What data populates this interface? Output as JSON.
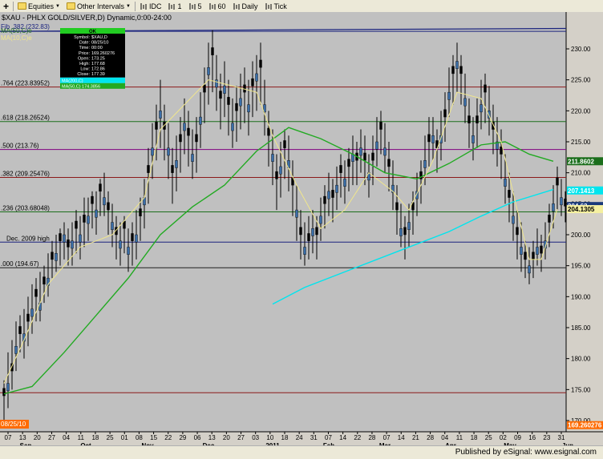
{
  "toolbar": {
    "items": [
      {
        "label": "Equities",
        "icon": "folder-icon",
        "dropdown": true
      },
      {
        "label": "Other Intervals",
        "icon": "folder-icon",
        "dropdown": true
      },
      {
        "label": "IDC",
        "icon": "bar-icon"
      },
      {
        "label": "1",
        "icon": "bar-icon"
      },
      {
        "label": "5",
        "icon": "bar-icon"
      },
      {
        "label": "60",
        "icon": "bar-icon"
      },
      {
        "label": "Daily",
        "icon": "bar-icon"
      },
      {
        "label": "Tick",
        "icon": "bar-icon"
      }
    ]
  },
  "footer": {
    "text": "Published by eSignal: www.esignal.com"
  },
  "chart_data": {
    "type": "candlestick",
    "title": "$XAU - PHLX GOLD/SILVER,D) Dynamic,0:00-24:00",
    "xlabel": "",
    "ylabel": "",
    "ylim": [
      170,
      235
    ],
    "grid": false,
    "y_ticks": [
      170.0,
      175.0,
      180.0,
      185.0,
      190.0,
      195.0,
      200.0,
      205.0,
      210.0,
      215.0,
      220.0,
      225.0,
      230.0
    ],
    "y_tick_labels": [
      "170.00",
      "175.00",
      "180.00",
      "185.00",
      "190.00",
      "195.00",
      "200.00",
      "205.00",
      "210.00",
      "215.00",
      "220.00",
      "225.00",
      "230.00"
    ],
    "date_labels": [
      "07",
      "13",
      "20",
      "27",
      "04",
      "11",
      "18",
      "25",
      "01",
      "08",
      "15",
      "22",
      "29",
      "06",
      "13",
      "20",
      "27",
      "03",
      "10",
      "18",
      "24",
      "31",
      "07",
      "14",
      "22",
      "28",
      "07",
      "14",
      "21",
      "28",
      "04",
      "11",
      "18",
      "25",
      "02",
      "09",
      "16",
      "23",
      "31"
    ],
    "month_labels": [
      "Sep",
      "Oct",
      "Nov",
      "Dec",
      "2011",
      "Feb",
      "Mar",
      "Apr",
      "May",
      "Jun"
    ],
    "horizontal_levels": [
      {
        "label": "Fib .382 (232.83)",
        "value": 232.83,
        "color": "#1a237e"
      },
      {
        "label": ".764 (223.83952)",
        "value": 223.84,
        "color": "#8b1a1a"
      },
      {
        "label": ".618 (218.26524)",
        "value": 218.27,
        "color": "#1b6e1b"
      },
      {
        "label": ".500 (213.76)",
        "value": 213.76,
        "color": "#800080"
      },
      {
        "label": ".382 (209.25476)",
        "value": 209.25,
        "color": "#8b1a1a"
      },
      {
        "label": ".236 (203.68048)",
        "value": 203.68,
        "color": "#1b6e1b"
      },
      {
        "label": "Dec. 2009 high",
        "value": 198.8,
        "color": "#1a237e"
      },
      {
        "label": ".000 (194.67)",
        "value": 194.67,
        "color": "#202020"
      },
      {
        "label": "",
        "value": 174.5,
        "color": "#8b1a1a"
      }
    ],
    "price_markers": [
      {
        "label": "211.8602",
        "value": 211.86,
        "color": "#1b6e1b",
        "text_color": "#ffffff"
      },
      {
        "label": "207.1413",
        "value": 207.14,
        "color": "#00e5ee",
        "text_color": "#ffffff"
      },
      {
        "label": "204.63",
        "value": 204.63,
        "color": "#1a3a7a",
        "text_color": "#ffffff"
      },
      {
        "label": "204.1305",
        "value": 204.13,
        "color": "#f5f0a0",
        "text_color": "#000000"
      },
      {
        "label": "169.260276",
        "value": 169.26,
        "color": "#ff6a00",
        "text_color": "#ffffff"
      }
    ],
    "lower_left_tag": "08/25/10",
    "data_window": {
      "title": "OK",
      "rows": [
        [
          "Symbol:",
          "$XAU,D"
        ],
        [
          "Date:",
          "08/25/10"
        ],
        [
          "Time:",
          "00:00"
        ],
        [
          "Price:",
          "169.260276"
        ],
        [
          "Open:",
          "173.25"
        ],
        [
          "High:",
          "177.68"
        ],
        [
          "Low:",
          "172.86"
        ],
        [
          "Close:",
          "177.39"
        ]
      ],
      "highlight_rows": [
        {
          "label": "MA(200,C)",
          "color": "#00e5ee"
        },
        {
          "label": "MA(50,C)",
          "value": "174.3856",
          "color": "#22aa22"
        }
      ]
    },
    "legend": [
      {
        "label": "MA(50,C)e",
        "color": "#1b6e1b"
      },
      {
        "label": "MA(10,C)e",
        "color": "#f0e68c"
      }
    ],
    "series": [
      {
        "name": "MA(200,C)",
        "color": "#00e5ee",
        "values": [
          [
            340,
            188.8
          ],
          [
            380,
            191.5
          ],
          [
            440,
            194.5
          ],
          [
            500,
            197.5
          ],
          [
            560,
            200.5
          ],
          [
            600,
            203
          ],
          [
            640,
            205.3
          ],
          [
            690,
            207.3
          ]
        ]
      },
      {
        "name": "MA(50,C)",
        "color": "#22aa22",
        "values": [
          [
            5,
            174.3
          ],
          [
            40,
            175.5
          ],
          [
            80,
            181
          ],
          [
            120,
            187
          ],
          [
            160,
            193
          ],
          [
            200,
            200
          ],
          [
            240,
            204.5
          ],
          [
            280,
            208
          ],
          [
            320,
            213.5
          ],
          [
            360,
            217.3
          ],
          [
            400,
            215.5
          ],
          [
            440,
            213
          ],
          [
            480,
            210
          ],
          [
            520,
            209
          ],
          [
            560,
            211.5
          ],
          [
            600,
            214.5
          ],
          [
            630,
            215
          ],
          [
            660,
            213
          ],
          [
            690,
            211.86
          ]
        ]
      },
      {
        "name": "MA(10,C)",
        "color": "#f0e68c",
        "values": [
          [
            5,
            176
          ],
          [
            30,
            183
          ],
          [
            60,
            192
          ],
          [
            100,
            198
          ],
          [
            140,
            200
          ],
          [
            180,
            206
          ],
          [
            200,
            217
          ],
          [
            230,
            221
          ],
          [
            260,
            225
          ],
          [
            290,
            224
          ],
          [
            320,
            223
          ],
          [
            340,
            216
          ],
          [
            370,
            208
          ],
          [
            400,
            201
          ],
          [
            430,
            204
          ],
          [
            460,
            210
          ],
          [
            490,
            207
          ],
          [
            510,
            204
          ],
          [
            540,
            212
          ],
          [
            570,
            223
          ],
          [
            600,
            222
          ],
          [
            625,
            215
          ],
          [
            645,
            204
          ],
          [
            660,
            196
          ],
          [
            675,
            196
          ],
          [
            695,
            204.13
          ]
        ]
      }
    ],
    "bars": [
      [
        5,
        174,
        169,
        176.5
      ],
      [
        10,
        176,
        172,
        181
      ],
      [
        15,
        178,
        175,
        183
      ],
      [
        20,
        182,
        178,
        186
      ],
      [
        25,
        184,
        181,
        187
      ],
      [
        30,
        184,
        180,
        188
      ],
      [
        35,
        186,
        182,
        190
      ],
      [
        40,
        188,
        184,
        192
      ],
      [
        45,
        190,
        186,
        193
      ],
      [
        50,
        189,
        186,
        194
      ],
      [
        55,
        192,
        189,
        195
      ],
      [
        60,
        193,
        190,
        197
      ],
      [
        65,
        196,
        193,
        199
      ],
      [
        70,
        197,
        194,
        200
      ],
      [
        75,
        199,
        195,
        201
      ],
      [
        80,
        200,
        196,
        202
      ],
      [
        85,
        198,
        195,
        201
      ],
      [
        90,
        199,
        195,
        202
      ],
      [
        95,
        201,
        197,
        204
      ],
      [
        100,
        200,
        196,
        203
      ],
      [
        105,
        202,
        198,
        206
      ],
      [
        110,
        203,
        199,
        206
      ],
      [
        115,
        205,
        201,
        207
      ],
      [
        120,
        204,
        200,
        207
      ],
      [
        125,
        207,
        203,
        209
      ],
      [
        130,
        206,
        203,
        210
      ],
      [
        135,
        204,
        200,
        207
      ],
      [
        140,
        202,
        198,
        205
      ],
      [
        145,
        200,
        196,
        203
      ],
      [
        150,
        199,
        195,
        202
      ],
      [
        155,
        201,
        197,
        203
      ],
      [
        160,
        198,
        194,
        201
      ],
      [
        165,
        199,
        195,
        202
      ],
      [
        170,
        200,
        196,
        204
      ],
      [
        175,
        203,
        199,
        206
      ],
      [
        180,
        206,
        201,
        209
      ],
      [
        185,
        210,
        205,
        214
      ],
      [
        190,
        214,
        209,
        218
      ],
      [
        195,
        217,
        212,
        221
      ],
      [
        200,
        220,
        214,
        225
      ],
      [
        205,
        217,
        212,
        221
      ],
      [
        210,
        214,
        209,
        218
      ],
      [
        215,
        210,
        205,
        214
      ],
      [
        220,
        212,
        207,
        216
      ],
      [
        225,
        215,
        210,
        219
      ],
      [
        230,
        218,
        213,
        222
      ],
      [
        235,
        216,
        211,
        220
      ],
      [
        240,
        213,
        209,
        217
      ],
      [
        245,
        215,
        210,
        219
      ],
      [
        250,
        219,
        214,
        223
      ],
      [
        255,
        223,
        218,
        227
      ],
      [
        260,
        227,
        221,
        231
      ],
      [
        265,
        229,
        223,
        233
      ],
      [
        270,
        225,
        220,
        229
      ],
      [
        275,
        222,
        217,
        226
      ],
      [
        280,
        224,
        219,
        228
      ],
      [
        285,
        221,
        216,
        225
      ],
      [
        290,
        218,
        214,
        222
      ],
      [
        295,
        220,
        215,
        224
      ],
      [
        300,
        222,
        217,
        226
      ],
      [
        305,
        223,
        218,
        227
      ],
      [
        310,
        221,
        216,
        225
      ],
      [
        315,
        224,
        219,
        228
      ],
      [
        320,
        226,
        220,
        229
      ],
      [
        325,
        227,
        221,
        231
      ],
      [
        330,
        221,
        216,
        225
      ],
      [
        335,
        216,
        211,
        220
      ],
      [
        340,
        213,
        208,
        217
      ],
      [
        345,
        209,
        204,
        213
      ],
      [
        350,
        211,
        206,
        215
      ],
      [
        355,
        214,
        209,
        217
      ],
      [
        360,
        212,
        207,
        216
      ],
      [
        365,
        208,
        203,
        212
      ],
      [
        370,
        204,
        199,
        208
      ],
      [
        375,
        200,
        196,
        204
      ],
      [
        380,
        198,
        195,
        202
      ],
      [
        385,
        199,
        196,
        203
      ],
      [
        390,
        201,
        197,
        204
      ],
      [
        395,
        200,
        196,
        203
      ],
      [
        400,
        203,
        199,
        206
      ],
      [
        405,
        205,
        201,
        208
      ],
      [
        410,
        207,
        203,
        210
      ],
      [
        415,
        206,
        202,
        209
      ],
      [
        420,
        208,
        204,
        211
      ],
      [
        425,
        210,
        206,
        213
      ],
      [
        430,
        209,
        205,
        212
      ],
      [
        435,
        211,
        207,
        214
      ],
      [
        440,
        213,
        208,
        216
      ],
      [
        445,
        212,
        208,
        215
      ],
      [
        450,
        214,
        210,
        217
      ],
      [
        455,
        212,
        208,
        216
      ],
      [
        460,
        210,
        206,
        213
      ],
      [
        465,
        212,
        208,
        216
      ],
      [
        470,
        215,
        211,
        219
      ],
      [
        475,
        217,
        213,
        220
      ],
      [
        480,
        214,
        210,
        218
      ],
      [
        485,
        211,
        207,
        215
      ],
      [
        490,
        208,
        204,
        212
      ],
      [
        495,
        204,
        200,
        208
      ],
      [
        500,
        201,
        198,
        205
      ],
      [
        505,
        200,
        196,
        203
      ],
      [
        510,
        202,
        198,
        205
      ],
      [
        515,
        204,
        200,
        207
      ],
      [
        520,
        207,
        203,
        210
      ],
      [
        525,
        209,
        205,
        212
      ],
      [
        530,
        212,
        208,
        216
      ],
      [
        535,
        215,
        211,
        219
      ],
      [
        540,
        216,
        212,
        219
      ],
      [
        545,
        214,
        210,
        217
      ],
      [
        550,
        216,
        212,
        220
      ],
      [
        555,
        219,
        215,
        223
      ],
      [
        560,
        223,
        219,
        227
      ],
      [
        565,
        226,
        221,
        229
      ],
      [
        570,
        228,
        223,
        231
      ],
      [
        575,
        226,
        221,
        229
      ],
      [
        580,
        222,
        218,
        226
      ],
      [
        585,
        218,
        214,
        222
      ],
      [
        590,
        216,
        212,
        219
      ],
      [
        595,
        218,
        214,
        222
      ],
      [
        600,
        221,
        217,
        225
      ],
      [
        605,
        223,
        218,
        226
      ],
      [
        610,
        220,
        216,
        224
      ],
      [
        615,
        217,
        213,
        221
      ],
      [
        620,
        215,
        211,
        219
      ],
      [
        625,
        213,
        209,
        217
      ],
      [
        630,
        209,
        205,
        213
      ],
      [
        635,
        206,
        202,
        210
      ],
      [
        640,
        203,
        199,
        207
      ],
      [
        645,
        200,
        196,
        204
      ],
      [
        650,
        198,
        194,
        202
      ],
      [
        655,
        196,
        193,
        199
      ],
      [
        660,
        195,
        192,
        198
      ],
      [
        665,
        196,
        193,
        199
      ],
      [
        670,
        198,
        195,
        201
      ],
      [
        675,
        197,
        194,
        200
      ],
      [
        680,
        199,
        196,
        202
      ],
      [
        685,
        202,
        198,
        205
      ],
      [
        690,
        205,
        201,
        208
      ],
      [
        695,
        208,
        204,
        211
      ],
      [
        700,
        206,
        203,
        209
      ],
      [
        705,
        204.6,
        202,
        207
      ]
    ]
  }
}
